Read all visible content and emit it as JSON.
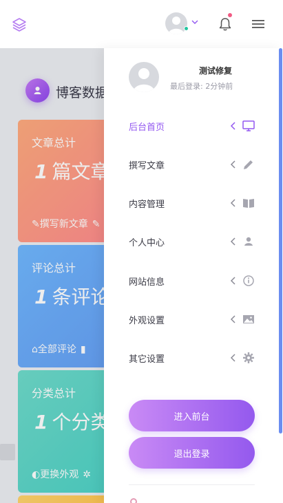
{
  "header": {
    "logo_icon": "layers-icon",
    "avatar_icon": "user-avatar",
    "status_color": "#23c6a0",
    "notification_icon": "bell-icon",
    "notification_dot_color": "#f15a83",
    "menu_icon": "hamburger-icon"
  },
  "main": {
    "title": "博客数据",
    "cards": [
      {
        "label": "文章总计",
        "value_num": "1",
        "value_text": "篇文章",
        "links": [
          "✎撰写新文章",
          "✎"
        ]
      },
      {
        "label": "评论总计",
        "value_num": "1",
        "value_text": "条评论",
        "links": [
          "⌂全部评论",
          "▮"
        ]
      },
      {
        "label": "分类总计",
        "value_num": "1",
        "value_text": "个分类",
        "links": [
          "◐更换外观",
          "✲"
        ]
      }
    ]
  },
  "drawer": {
    "profile": {
      "name": "测试修复",
      "last_login": "最后登录: 2分钟前"
    },
    "nav": [
      {
        "label": "后台首页",
        "icon": "monitor-icon",
        "active": true
      },
      {
        "label": "撰写文章",
        "icon": "pencil-icon",
        "active": false
      },
      {
        "label": "内容管理",
        "icon": "book-icon",
        "active": false
      },
      {
        "label": "个人中心",
        "icon": "user-icon",
        "active": false
      },
      {
        "label": "网站信息",
        "icon": "info-icon",
        "active": false
      },
      {
        "label": "外观设置",
        "icon": "image-icon",
        "active": false
      },
      {
        "label": "其它设置",
        "icon": "gear-icon",
        "active": false
      }
    ],
    "buttons": {
      "enter_frontend": "进入前台",
      "logout": "退出登录"
    }
  },
  "colors": {
    "accent": "#9256f0",
    "gradient_start": "#c98af5",
    "gradient_end": "#9459ee"
  }
}
